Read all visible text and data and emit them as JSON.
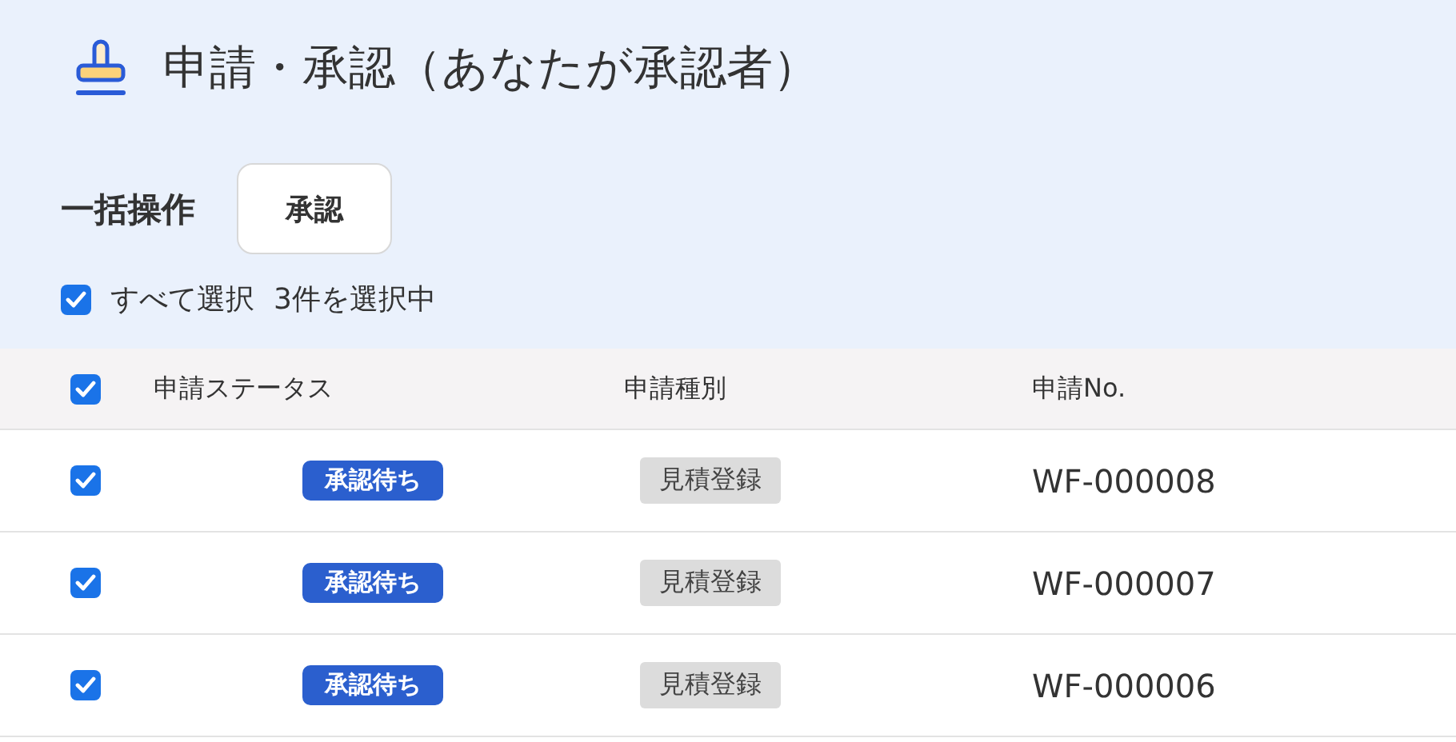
{
  "title": "申請・承認（あなたが承認者）",
  "bulk_actions": {
    "label": "一括操作",
    "buttons": [
      "承認"
    ]
  },
  "select_all": {
    "label": "すべて選択",
    "checked": true,
    "count_text": "3件を選択中"
  },
  "table": {
    "header_checked": true,
    "columns": [
      "申請ステータス",
      "申請種別",
      "申請No."
    ],
    "rows": [
      {
        "checked": true,
        "status": "承認待ち",
        "type": "見積登録",
        "number": "WF-000008"
      },
      {
        "checked": true,
        "status": "承認待ち",
        "type": "見積登録",
        "number": "WF-000007"
      },
      {
        "checked": true,
        "status": "承認待ち",
        "type": "見積登録",
        "number": "WF-000006"
      }
    ]
  }
}
